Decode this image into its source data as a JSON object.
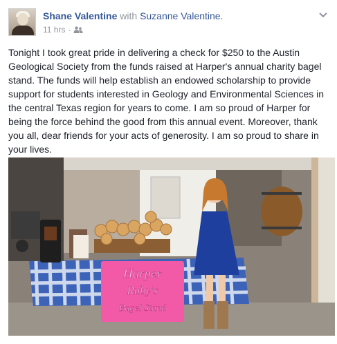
{
  "post": {
    "author": "Shane Valentine",
    "with_text": "with",
    "tagged": "Suzanne Valentine.",
    "time": "11 hrs",
    "separator": "·",
    "privacy_icon": "friends-icon",
    "body": "Tonight I took great pride in delivering a check for $250 to the Austin Geological Society from the funds raised at Harper's annual charity bagel stand. The funds will help establish an endowed scholarship to provide support for students interested in Geology and Environmental Sciences in the central Texas region for years to come. I am so proud of Harper for being the force behind the good from this annual event. Moreover, thank you all, dear friends for your acts of generosity. I am so proud to share in your lives."
  },
  "photo": {
    "sign_lines": [
      "Harper",
      "Ruby's",
      "Bagel Stand"
    ],
    "colors": {
      "sign_pink": "#f25aa8",
      "tablecloth_blue": "#3d63b8",
      "dress_blue": "#1f3f9e"
    }
  },
  "colors": {
    "link": "#365899",
    "muted": "#90949c",
    "text": "#1d2129"
  }
}
